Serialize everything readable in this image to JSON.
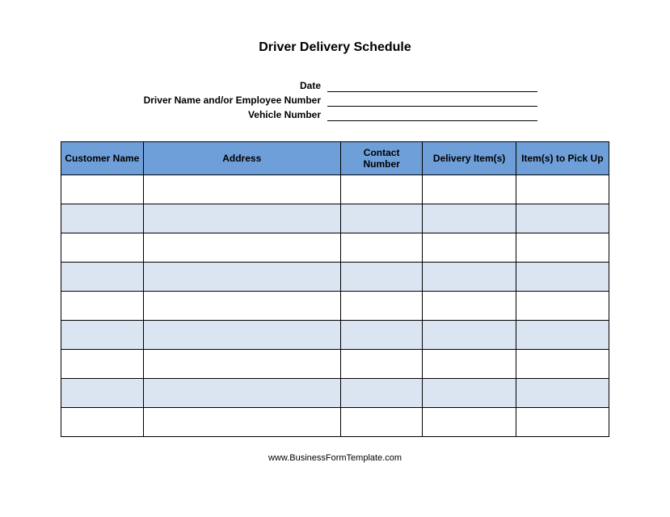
{
  "title": "Driver Delivery Schedule",
  "fields": {
    "date_label": "Date",
    "driver_label": "Driver Name and/or Employee Number",
    "vehicle_label": "Vehicle Number"
  },
  "table": {
    "headers": {
      "customer": "Customer Name",
      "address": "Address",
      "contact": "Contact Number",
      "delivery": "Delivery Item(s)",
      "pickup": "Item(s) to Pick Up"
    }
  },
  "footer": "www.BusinessFormTemplate.com"
}
